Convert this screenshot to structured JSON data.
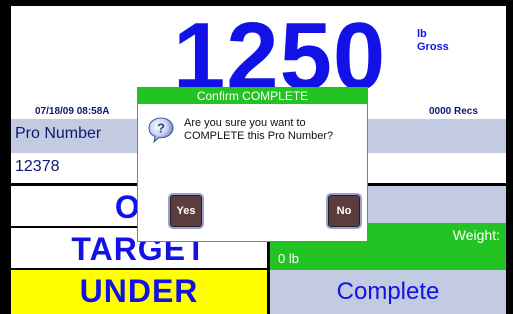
{
  "display": {
    "weight": "1250",
    "unit": "lb",
    "mode": "Gross",
    "datetime": "07/18/09 08:58A",
    "records": "0000 Recs"
  },
  "fields": {
    "pro_number_label": "Pro Number",
    "pro_number_value": "12378",
    "over_label": "OV",
    "target_label": "TARGET",
    "under_label": "UNDER",
    "weight_label": "Weight:",
    "weight_value": "0 lb",
    "complete_label": "Complete"
  },
  "dialog": {
    "title": "Confirm COMPLETE",
    "message": "Are you sure you want to\nCOMPLETE this Pro Number?",
    "icon": "question-icon",
    "yes_label": "Yes",
    "no_label": "No"
  },
  "colors": {
    "weight_blue": "#1212e6",
    "panel_blue": "#c2cbe2",
    "green": "#22c322",
    "under_yellow": "#ffff00"
  }
}
